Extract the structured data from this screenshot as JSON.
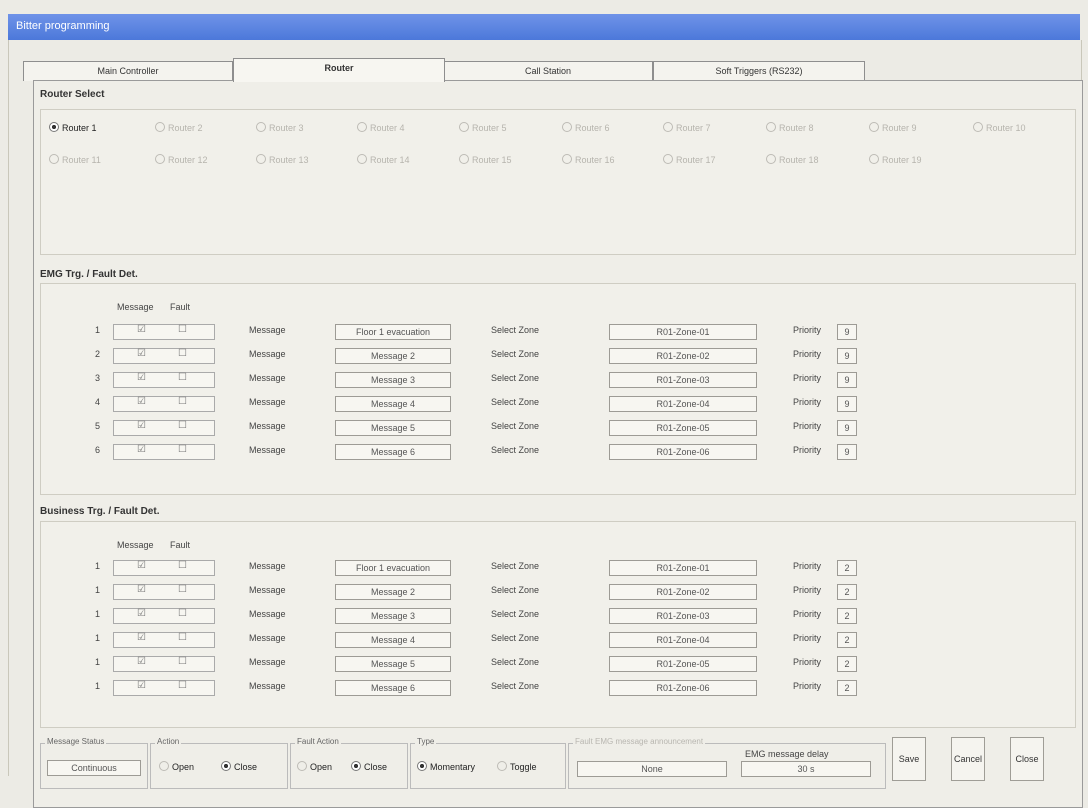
{
  "window": {
    "title": "Bitter programming"
  },
  "tabs": [
    "Main Controller",
    "Router",
    "Call Station",
    "Soft Triggers (RS232)"
  ],
  "router_select": {
    "title": "Router Select",
    "routers": [
      "Router 1",
      "Router 2",
      "Router 3",
      "Router 4",
      "Router 5",
      "Router 6",
      "Router 7",
      "Router 8",
      "Router 9",
      "Router 10",
      "Router 11",
      "Router 12",
      "Router 13",
      "Router 14",
      "Router 15",
      "Router 16",
      "Router 17",
      "Router 18",
      "Router 19"
    ]
  },
  "emg": {
    "title": "EMG Trg. / Fault Det.",
    "col_message": "Message",
    "col_fault": "Fault",
    "message_label": "Message",
    "zone_label": "Select Zone",
    "priority_label": "Priority",
    "rows": [
      {
        "index": "1",
        "message": "Floor 1 evacuation",
        "zone": "R01-Zone-01",
        "priority": "9"
      },
      {
        "index": "2",
        "message": "Message 2",
        "zone": "R01-Zone-02",
        "priority": "9"
      },
      {
        "index": "3",
        "message": "Message 3",
        "zone": "R01-Zone-03",
        "priority": "9"
      },
      {
        "index": "4",
        "message": "Message 4",
        "zone": "R01-Zone-04",
        "priority": "9"
      },
      {
        "index": "5",
        "message": "Message 5",
        "zone": "R01-Zone-05",
        "priority": "9"
      },
      {
        "index": "6",
        "message": "Message 6",
        "zone": "R01-Zone-06",
        "priority": "9"
      }
    ]
  },
  "business": {
    "title": "Business Trg. / Fault Det.",
    "col_message": "Message",
    "col_fault": "Fault",
    "message_label": "Message",
    "zone_label": "Select Zone",
    "priority_label": "Priority",
    "rows": [
      {
        "index": "1",
        "message": "Floor 1 evacuation",
        "zone": "R01-Zone-01",
        "priority": "2"
      },
      {
        "index": "1",
        "message": "Message 2",
        "zone": "R01-Zone-02",
        "priority": "2"
      },
      {
        "index": "1",
        "message": "Message 3",
        "zone": "R01-Zone-03",
        "priority": "2"
      },
      {
        "index": "1",
        "message": "Message 4",
        "zone": "R01-Zone-04",
        "priority": "2"
      },
      {
        "index": "1",
        "message": "Message 5",
        "zone": "R01-Zone-05",
        "priority": "2"
      },
      {
        "index": "1",
        "message": "Message 6",
        "zone": "R01-Zone-06",
        "priority": "2"
      }
    ]
  },
  "footer": {
    "message_status_label": "Message Status",
    "message_status": "Continuous",
    "action_label": "Action",
    "action_open": "Open",
    "action_close": "Close",
    "fault_action_label": "Fault Action",
    "fault_open": "Open",
    "fault_close": "Close",
    "type_label": "Type",
    "type_momentary": "Momentary",
    "type_toggle": "Toggle",
    "fault_message_label": "Fault EMG message announcement",
    "fault_message": "None",
    "emg_delay_label": "EMG message delay",
    "emg_delay": "30 s",
    "save": "Save",
    "cancel": "Cancel",
    "close": "Close"
  }
}
